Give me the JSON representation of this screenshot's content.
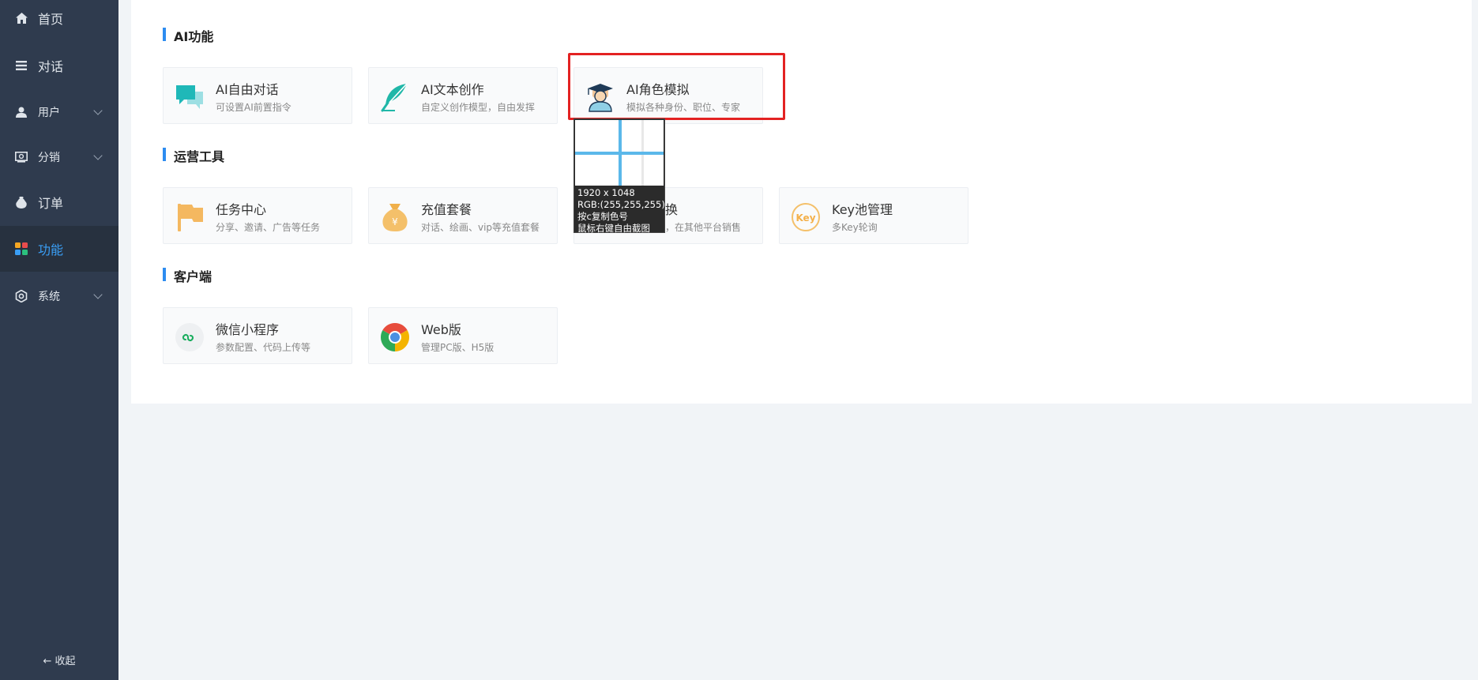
{
  "sidebar": {
    "items": [
      {
        "label": "首页",
        "icon": "home-icon"
      },
      {
        "label": "对话",
        "icon": "list-icon"
      },
      {
        "label": "用户",
        "icon": "user-icon"
      },
      {
        "label": "分销",
        "icon": "distribution-icon"
      },
      {
        "label": "订单",
        "icon": "order-bag-icon"
      },
      {
        "label": "功能",
        "icon": "grid-apps-icon",
        "active": true
      },
      {
        "label": "系统",
        "icon": "gear-icon"
      }
    ],
    "collapse_label": "← 收起",
    "active_color": "#3a9ef5"
  },
  "sections": [
    {
      "title": "AI功能",
      "cards": [
        {
          "title": "AI自由对话",
          "subtitle": "可设置AI前置指令",
          "icon": "chat-bubbles-icon"
        },
        {
          "title": "AI文本创作",
          "subtitle": "自定义创作模型，自由发挥",
          "icon": "feather-icon"
        },
        {
          "title": "AI角色模拟",
          "subtitle": "模拟各种身份、职位、专家",
          "icon": "graduate-icon"
        }
      ]
    },
    {
      "title": "运营工具",
      "cards": [
        {
          "title": "任务中心",
          "subtitle": "分享、邀请、广告等任务",
          "icon": "flag-icon"
        },
        {
          "title": "充值套餐",
          "subtitle": "对话、绘画、vip等充值套餐",
          "icon": "money-bag-icon"
        },
        {
          "title": "换",
          "subtitle": "，在其他平台销售",
          "icon": "exchange-icon"
        },
        {
          "title": "Key池管理",
          "subtitle": "多Key轮询",
          "icon": "key-badge-icon"
        }
      ]
    },
    {
      "title": "客户端",
      "cards": [
        {
          "title": "微信小程序",
          "subtitle": "参数配置、代码上传等",
          "icon": "mini-program-icon"
        },
        {
          "title": "Web版",
          "subtitle": "管理PC版、H5版",
          "icon": "chrome-icon"
        }
      ]
    }
  ],
  "screenshot_tool": {
    "size": "1920 x 1048",
    "rgb": "RGB:(255,255,255)",
    "hint_copy": "按c复制色号",
    "hint_right": "鼠标右键自由截图"
  },
  "colors": {
    "sidebar_bg": "#2f3b4e",
    "accent": "#2d8cf0",
    "highlight_border": "#e32222"
  }
}
